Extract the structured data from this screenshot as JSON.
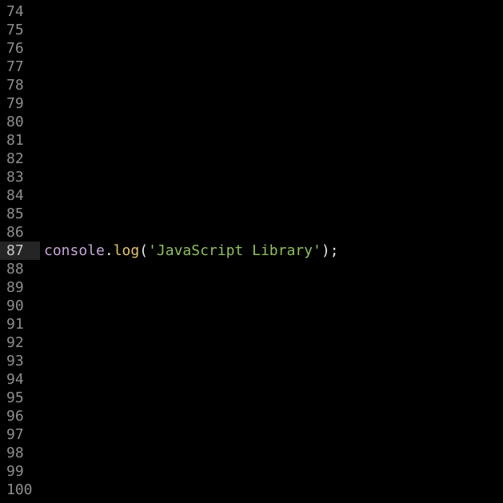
{
  "editor": {
    "active_line": "87",
    "colors": {
      "background": "#000000",
      "gutter_text": "#8e8e8e",
      "active_gutter_bg": "#252525",
      "identifier": "#c5a5d8",
      "method": "#e4c46c",
      "string": "#8fbf5e",
      "punctuation": "#e8e8e8"
    },
    "line_numbers": [
      "74",
      "75",
      "76",
      "77",
      "78",
      "79",
      "80",
      "81",
      "82",
      "83",
      "84",
      "85",
      "86",
      "87",
      "88",
      "89",
      "90",
      "91",
      "92",
      "93",
      "94",
      "95",
      "96",
      "97",
      "98",
      "99",
      "100"
    ],
    "code_line": {
      "object": "console",
      "dot": ".",
      "method": "log",
      "open_paren": "(",
      "string": "'JavaScript Library'",
      "close": ");"
    }
  }
}
